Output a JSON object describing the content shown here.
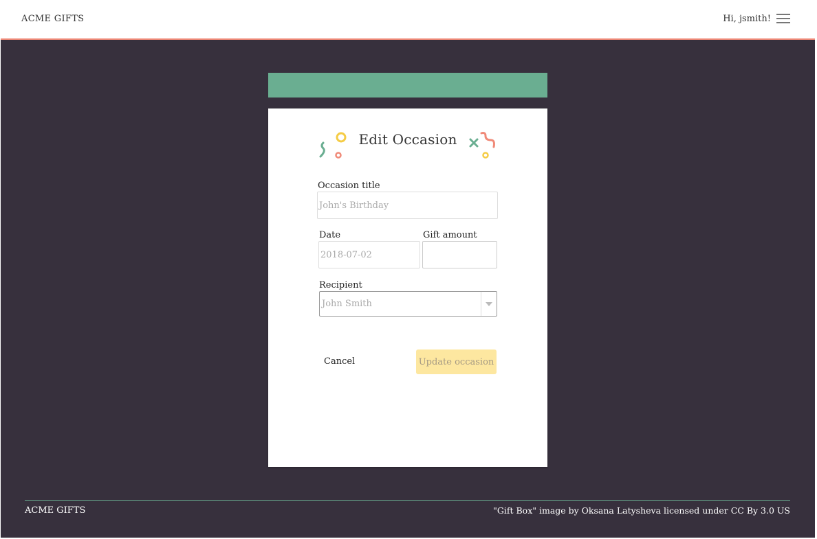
{
  "header": {
    "brand": "ACME GIFTS",
    "greeting": "Hi, jsmith!",
    "menu_icon": "hamburger-menu-icon"
  },
  "form": {
    "title": "Edit Occasion",
    "occasion_title": {
      "label": "Occasion title",
      "placeholder": "John's Birthday",
      "value": ""
    },
    "date": {
      "label": "Date",
      "placeholder": "2018-07-02",
      "value": ""
    },
    "gift_amount": {
      "label": "Gift amount",
      "value": ""
    },
    "recipient": {
      "label": "Recipient",
      "selected": "John Smith"
    },
    "cancel_label": "Cancel",
    "submit_label": "Update occasion"
  },
  "footer": {
    "brand": "ACME GIFTS",
    "credit": "\"Gift Box\" image by Oksana Latysheva licensed under CC By 3.0 US"
  },
  "colors": {
    "background": "#37303d",
    "accent_green": "#6aae91",
    "accent_coral": "#f08a78",
    "accent_yellow": "#f5cc45",
    "button_disabled": "#fde7a0"
  }
}
